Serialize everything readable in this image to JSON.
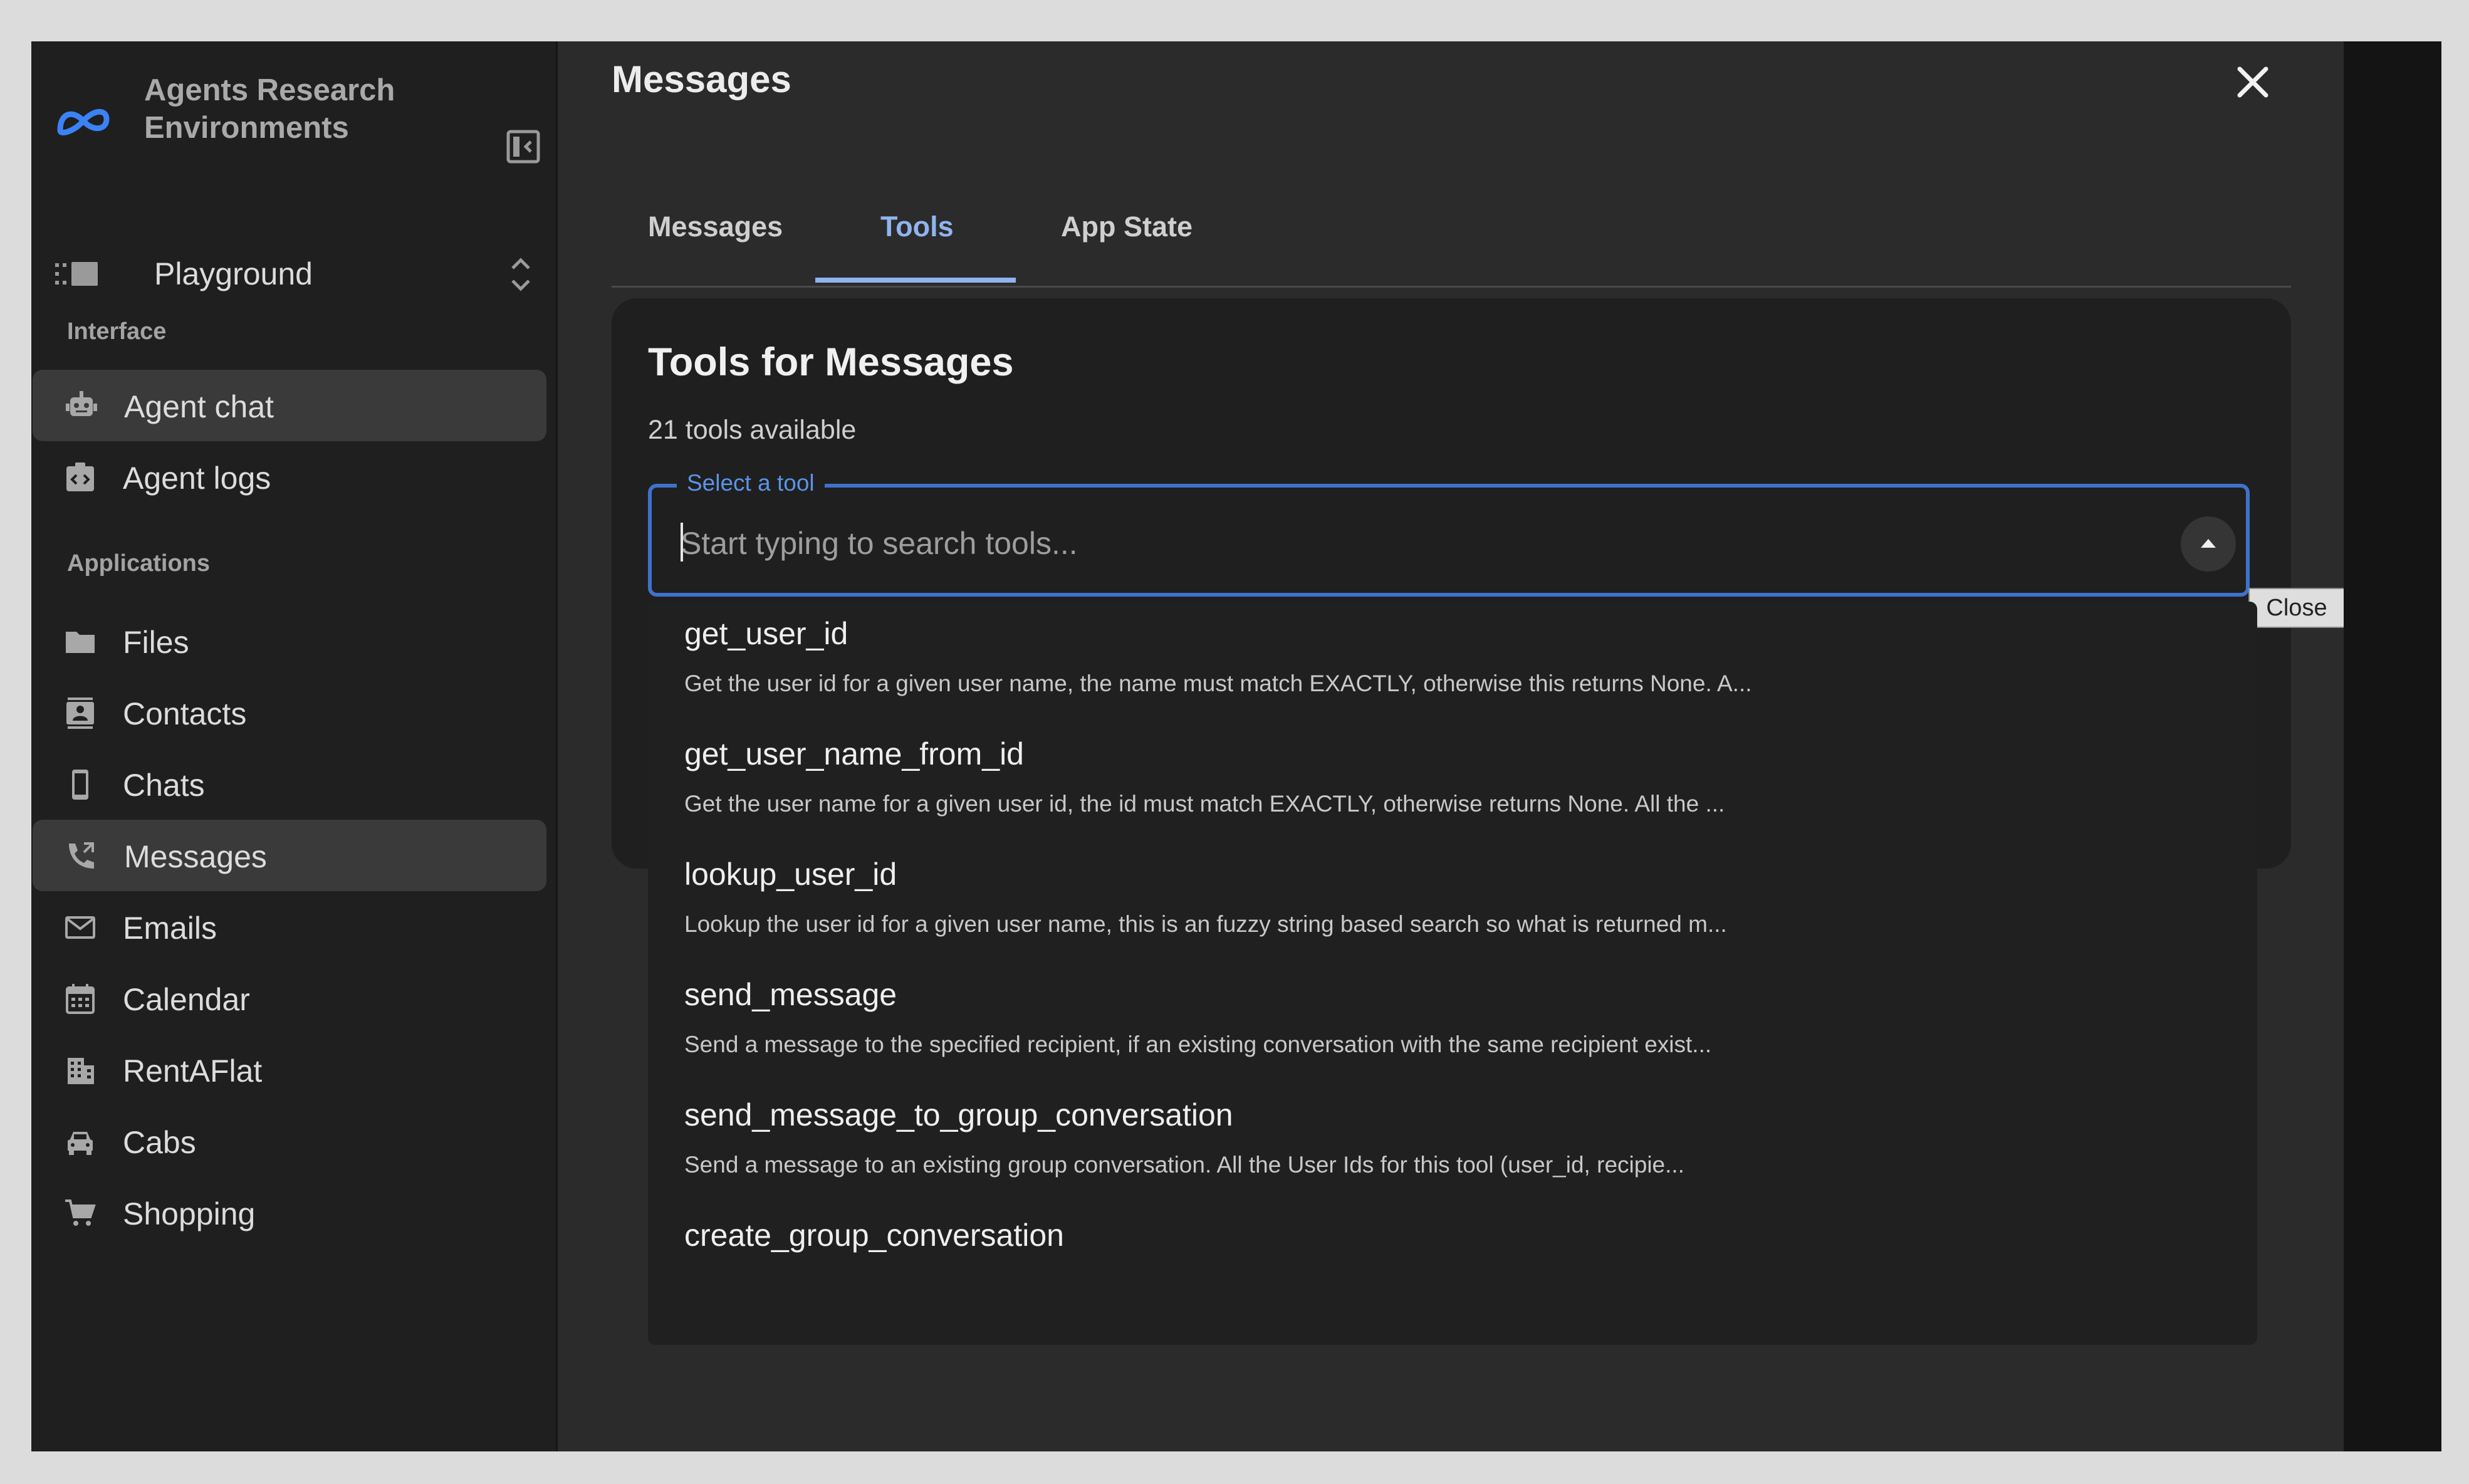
{
  "brand": {
    "name": "Agents Research Environments"
  },
  "workspace": {
    "label": "Playground"
  },
  "sidebar": {
    "sections": [
      {
        "title": "Interface",
        "items": [
          {
            "label": "Agent chat",
            "icon": "robot-icon",
            "active": true
          },
          {
            "label": "Agent logs",
            "icon": "code-badge-icon",
            "active": false
          }
        ]
      },
      {
        "title": "Applications",
        "items": [
          {
            "label": "Files",
            "icon": "folder-icon",
            "active": false
          },
          {
            "label": "Contacts",
            "icon": "contact-card-icon",
            "active": false
          },
          {
            "label": "Chats",
            "icon": "phone-icon",
            "active": false
          },
          {
            "label": "Messages",
            "icon": "phone-forward-icon",
            "active": true
          },
          {
            "label": "Emails",
            "icon": "mail-icon",
            "active": false
          },
          {
            "label": "Calendar",
            "icon": "calendar-icon",
            "active": false
          },
          {
            "label": "RentAFlat",
            "icon": "building-icon",
            "active": false
          },
          {
            "label": "Cabs",
            "icon": "taxi-icon",
            "active": false
          },
          {
            "label": "Shopping",
            "icon": "cart-icon",
            "active": false
          }
        ]
      }
    ]
  },
  "panel": {
    "title": "Messages",
    "tabs": [
      {
        "label": "Messages",
        "active": false
      },
      {
        "label": "Tools",
        "active": true
      },
      {
        "label": "App State",
        "active": false
      }
    ],
    "card": {
      "title": "Tools for Messages",
      "subtitle": "21 tools available",
      "select": {
        "label": "Select a tool",
        "placeholder": "Start typing to search tools...",
        "value": ""
      },
      "tooltip": "Close"
    },
    "options": [
      {
        "name": "get_user_id",
        "description": "Get the user id for a given user name, the name must match EXACTLY, otherwise this returns None. A..."
      },
      {
        "name": "get_user_name_from_id",
        "description": "Get the user name for a given user id, the id must match EXACTLY, otherwise returns None. All the ..."
      },
      {
        "name": "lookup_user_id",
        "description": "Lookup the user id for a given user name, this is an fuzzy string based search so what is returned m..."
      },
      {
        "name": "send_message",
        "description": "Send a message to the specified recipient, if an existing conversation with the same recipient exist..."
      },
      {
        "name": "send_message_to_group_conversation",
        "description": "Send a message to an existing group conversation. All the User Ids for this tool (user_id, recipie..."
      },
      {
        "name": "create_group_conversation",
        "description": ""
      }
    ]
  },
  "colors": {
    "accent": "#8fb4ee",
    "focus_border": "#3e72cc",
    "brand_logo": "#3b82f6",
    "background": "#2b2b2b",
    "sidebar": "#1f1f1f"
  }
}
